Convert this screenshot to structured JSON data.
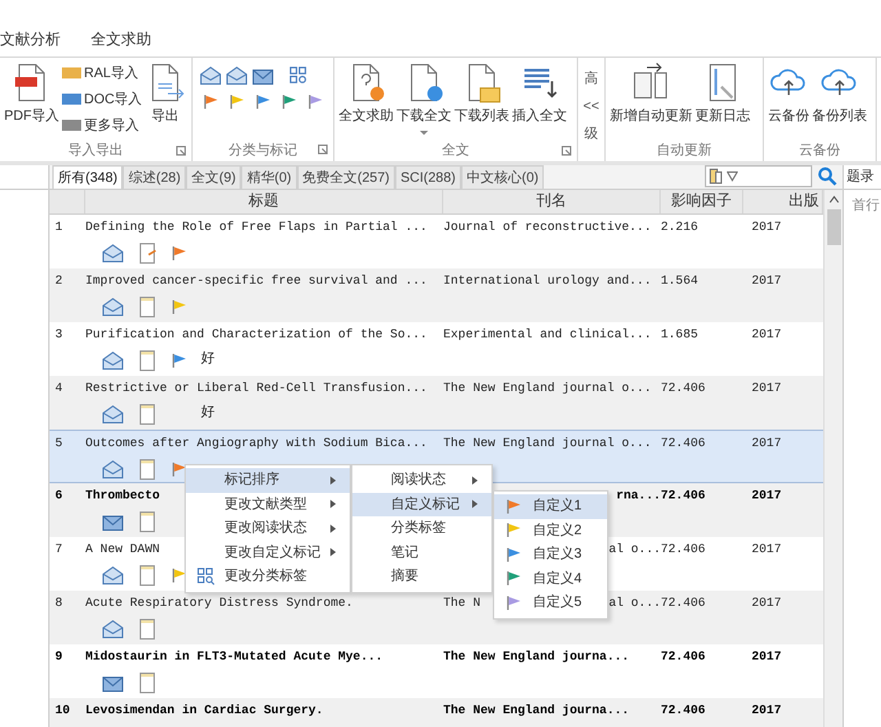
{
  "menu_tabs": [
    "文献分析",
    "全文求助"
  ],
  "ribbon": {
    "import_export": {
      "label": "导入导出",
      "pdf_import": "PDF导入",
      "small": [
        "RAL导入",
        "DOC导入",
        "更多导入"
      ],
      "export": "导出"
    },
    "classify": {
      "label": "分类与标记",
      "flags": [
        {
          "color": "#f07a2a"
        },
        {
          "color": "#f2c511"
        },
        {
          "color": "#3b8fe0"
        },
        {
          "color": "#20a07a"
        },
        {
          "color": "#a99be3"
        }
      ]
    },
    "fulltext": {
      "label": "全文",
      "buttons": [
        {
          "label": "全文求助",
          "dropdown": false
        },
        {
          "label": "下载全文",
          "dropdown": true
        },
        {
          "label": "下载列表",
          "dropdown": false
        },
        {
          "label": "插入全文",
          "dropdown": false
        }
      ]
    },
    "advanced": [
      "高",
      "<<",
      "级"
    ],
    "auto_update": {
      "label": "自动更新",
      "buttons": [
        "新增自动更新",
        "更新日志"
      ]
    },
    "cloud": {
      "label": "云备份",
      "buttons": [
        "云备份",
        "备份列表"
      ]
    }
  },
  "filter_tabs": [
    {
      "label": "所有(348)",
      "selected": true
    },
    {
      "label": "综述(28)",
      "selected": false
    },
    {
      "label": "全文(9)",
      "selected": false
    },
    {
      "label": "精华(0)",
      "selected": false
    },
    {
      "label": "免费全文(257)",
      "selected": false
    },
    {
      "label": "SCI(288)",
      "selected": false
    },
    {
      "label": "中文核心(0)",
      "selected": false
    }
  ],
  "columns": [
    "标题",
    "刊名",
    "影响因子",
    "出版"
  ],
  "rows": [
    {
      "no": "1",
      "title": "Defining the Role of Free Flaps in Partial ...",
      "journal": [
        "Journal of reconstructive..."
      ],
      "impact": "2.216",
      "year": "2017",
      "read": true,
      "note": true,
      "flag": {
        "color": "#f07a2a"
      },
      "selected": false
    },
    {
      "no": "2",
      "title": "Improved cancer-specific free survival and ...",
      "journal": [
        "International urology and..."
      ],
      "impact": "1.564",
      "year": "2017",
      "read": true,
      "note": false,
      "flag": {
        "color": "#f2c511"
      },
      "selected": false
    },
    {
      "no": "3",
      "title": "Purification and Characterization of the So...",
      "journal": [
        "Experimental and clinical..."
      ],
      "impact": "1.685",
      "year": "2017",
      "read": true,
      "note": false,
      "flag": {
        "color": "#3b8fe0"
      },
      "tag": "好",
      "selected": false
    },
    {
      "no": "4",
      "title": "Restrictive or Liberal Red-Cell Transfusion...",
      "journal": [
        "The New England journal o..."
      ],
      "impact": "72.406",
      "year": "2017",
      "read": true,
      "note": false,
      "tag": "好",
      "selected": false
    },
    {
      "no": "5",
      "title": "Outcomes after Angiography with Sodium Bica...",
      "journal": [
        "The New England journal o..."
      ],
      "impact": "72.406",
      "year": "2017",
      "read": true,
      "note": false,
      "flag": {
        "color": "#f07a2a"
      },
      "selected": true
    },
    {
      "no": "6",
      "title": "Thrombecto",
      "journal": [
        "rna..."
      ],
      "impact": "72.406",
      "year": "2017",
      "read": false,
      "note": false,
      "selected": false
    },
    {
      "no": "7",
      "title": "A New DAWN",
      "journal": [
        "al o..."
      ],
      "impact": "72.406",
      "year": "2017",
      "read": true,
      "note": false,
      "flag": {
        "color": "#f2c511"
      },
      "selected": false
    },
    {
      "no": "8",
      "title": "Acute Respiratory Distress Syndrome.",
      "journal": [
        "The N",
        "al o..."
      ],
      "impact": "72.406",
      "year": "2017",
      "read": true,
      "note": false,
      "selected": false
    },
    {
      "no": "9",
      "title": "Midostaurin in FLT3-Mutated Acute Mye...",
      "journal": [
        "The New England journa..."
      ],
      "impact": "72.406",
      "year": "2017",
      "read": false,
      "note": false,
      "selected": false
    },
    {
      "no": "10",
      "title": "Levosimendan in Cardiac Surgery.",
      "journal": [
        "The New England journa..."
      ],
      "impact": "72.406",
      "year": "2017",
      "read": false,
      "selected": false
    }
  ],
  "right_panel": {
    "header": "题录",
    "line": "首行"
  },
  "context_menu": [
    {
      "label": "标记排序",
      "submenu": true,
      "selected": true
    },
    {
      "label": "更改文献类型",
      "submenu": true,
      "selected": false
    },
    {
      "label": "更改阅读状态",
      "submenu": true,
      "selected": false
    },
    {
      "label": "更改自定义标记",
      "submenu": true,
      "selected": false
    },
    {
      "label": "更改分类标签",
      "submenu": false,
      "selected": false
    }
  ],
  "submenu": [
    {
      "label": "阅读状态",
      "submenu": true,
      "selected": false
    },
    {
      "label": "自定义标记",
      "submenu": true,
      "selected": true
    },
    {
      "label": "分类标签",
      "submenu": false,
      "selected": false
    },
    {
      "label": "笔记",
      "submenu": false,
      "selected": false
    },
    {
      "label": "摘要",
      "submenu": false,
      "selected": false
    }
  ],
  "flag_menu": [
    {
      "label": "自定义1",
      "color": "#f07a2a",
      "selected": true
    },
    {
      "label": "自定义2",
      "color": "#f2c511",
      "selected": false
    },
    {
      "label": "自定义3",
      "color": "#3b8fe0",
      "selected": false
    },
    {
      "label": "自定义4",
      "color": "#20a07a",
      "selected": false
    },
    {
      "label": "自定义5",
      "color": "#a99be3",
      "selected": false
    }
  ]
}
